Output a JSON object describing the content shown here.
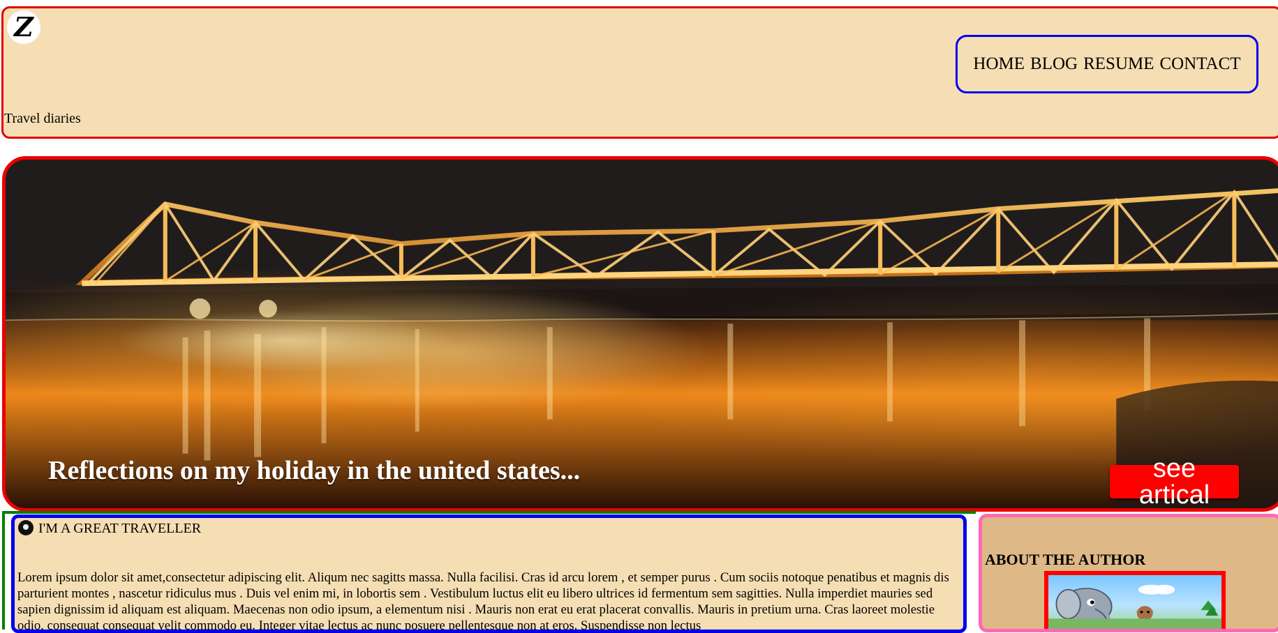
{
  "header": {
    "logo_letter": "Z",
    "tagline": "Travel diaries",
    "nav": [
      "HOME",
      "BLOG",
      "RESUME",
      "CONTACT"
    ]
  },
  "hero": {
    "title": "Reflections on my holiday in the united states...",
    "button_label": "see artical"
  },
  "article": {
    "heading": "I'M A GREAT TRAVELLER",
    "body": "Lorem ipsum dolor sit amet,consectetur adipiscing elit. Aliqum nec sagitts massa. Nulla facilisi. Cras id arcu lorem , et semper purus . Cum sociis notoque penatibus et magnis dis parturient montes , nascetur ridiculus mus . Duis vel enim mi, in lobortis sem . Vestibulum luctus elit eu libero ultrices id fermentum sem sagitties. Nulla imperdiet mauries sed sapien dignissim id aliquam est aliquam. Maecenas non odio ipsum, a elementum nisi . Mauris non erat eu erat placerat convallis. Mauris in pretium urna. Cras laoreet molestie odio, consequat consequat velit commodo eu. Integer vitae lectus ac nunc posuere pellentesque non at eros. Suspendisse non lectus"
  },
  "author": {
    "title": "ABOUT THE AUTHOR",
    "image_icon": "elephant-cartoon-image"
  },
  "colors": {
    "header_background": "#f5deb3",
    "frame_red": "#e00000",
    "nav_border": "#0000ee",
    "content_green": "#008000",
    "author_background": "#deb887",
    "author_border": "#ff69b4",
    "button_red": "#ff0000"
  }
}
